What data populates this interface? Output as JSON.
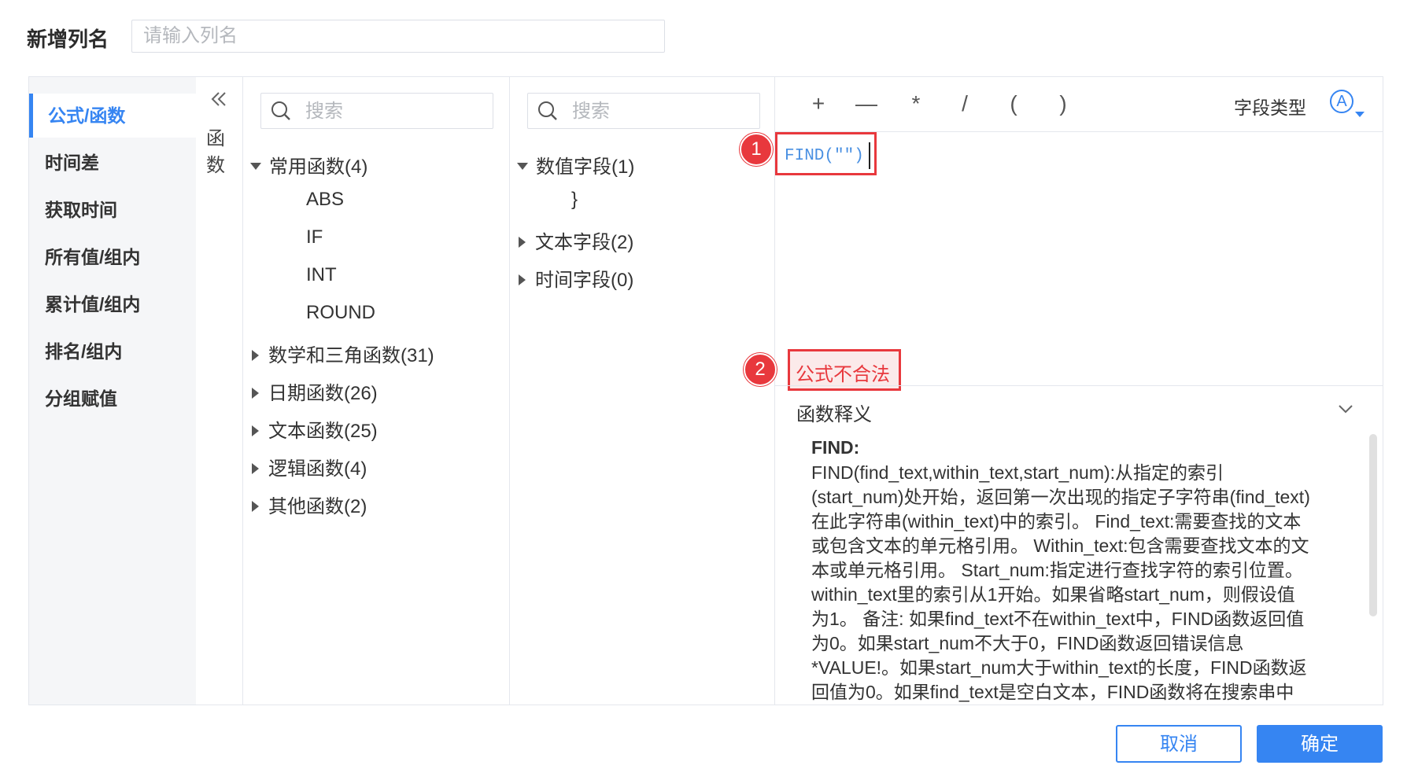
{
  "header": {
    "label": "新增列名",
    "name_placeholder": "请输入列名"
  },
  "sidebar": {
    "items": [
      {
        "label": "公式/函数",
        "active": true
      },
      {
        "label": "时间差"
      },
      {
        "label": "获取时间"
      },
      {
        "label": "所有值/组内"
      },
      {
        "label": "累计值/组内"
      },
      {
        "label": "排名/组内"
      },
      {
        "label": "分组赋值"
      }
    ]
  },
  "function_panel": {
    "collapse_icon": "double-chevron-left-icon",
    "vertical_label_1": "函",
    "vertical_label_2": "数",
    "search_placeholder": "搜索",
    "groups": [
      {
        "label": "常用函数(4)",
        "expanded": true,
        "children": [
          "ABS",
          "IF",
          "INT",
          "ROUND"
        ]
      },
      {
        "label": "数学和三角函数(31)",
        "expanded": false
      },
      {
        "label": "日期函数(26)",
        "expanded": false
      },
      {
        "label": "文本函数(25)",
        "expanded": false
      },
      {
        "label": "逻辑函数(4)",
        "expanded": false
      },
      {
        "label": "其他函数(2)",
        "expanded": false
      }
    ]
  },
  "field_panel": {
    "search_placeholder": "搜索",
    "groups": [
      {
        "label": "数值字段(1)",
        "expanded": true,
        "children": [
          "}"
        ]
      },
      {
        "label": "文本字段(2)",
        "expanded": false
      },
      {
        "label": "时间字段(0)",
        "expanded": false
      }
    ]
  },
  "editor": {
    "operators": [
      "+",
      "—",
      "*",
      "/",
      "(",
      ")"
    ],
    "field_type_label": "字段类型",
    "field_type_icon": "A",
    "formula": "FIND(\"\")",
    "error_text": "公式不合法",
    "badge_1": "1",
    "badge_2": "2"
  },
  "definition": {
    "title": "函数释义",
    "name": "FIND:",
    "lines": [
      "FIND(find_text,within_text,start_num):从指定的索引",
      "(start_num)处开始，返回第一次出现的指定子字符串(find_text)",
      "在此字符串(within_text)中的索引。 Find_text:需要查找的文本",
      "或包含文本的单元格引用。 Within_text:包含需要查找文本的文",
      "本或单元格引用。 Start_num:指定进行查找字符的索引位置。",
      "within_text里的索引从1开始。如果省略start_num，则假设值",
      "为1。 备注: 如果find_text不在within_text中，FIND函数返回值",
      "为0。如果start_num不大于0，FIND函数返回错误信息",
      "*VALUE!。如果start_num大于within_text的长度，FIND函数返",
      "回值为0。如果find_text是空白文本，FIND函数将在搜索串中"
    ]
  },
  "footer": {
    "cancel": "取消",
    "ok": "确定"
  },
  "colors": {
    "accent": "#3685f2",
    "error": "#e8383d",
    "sidebar_bg": "#f5f6f8"
  }
}
